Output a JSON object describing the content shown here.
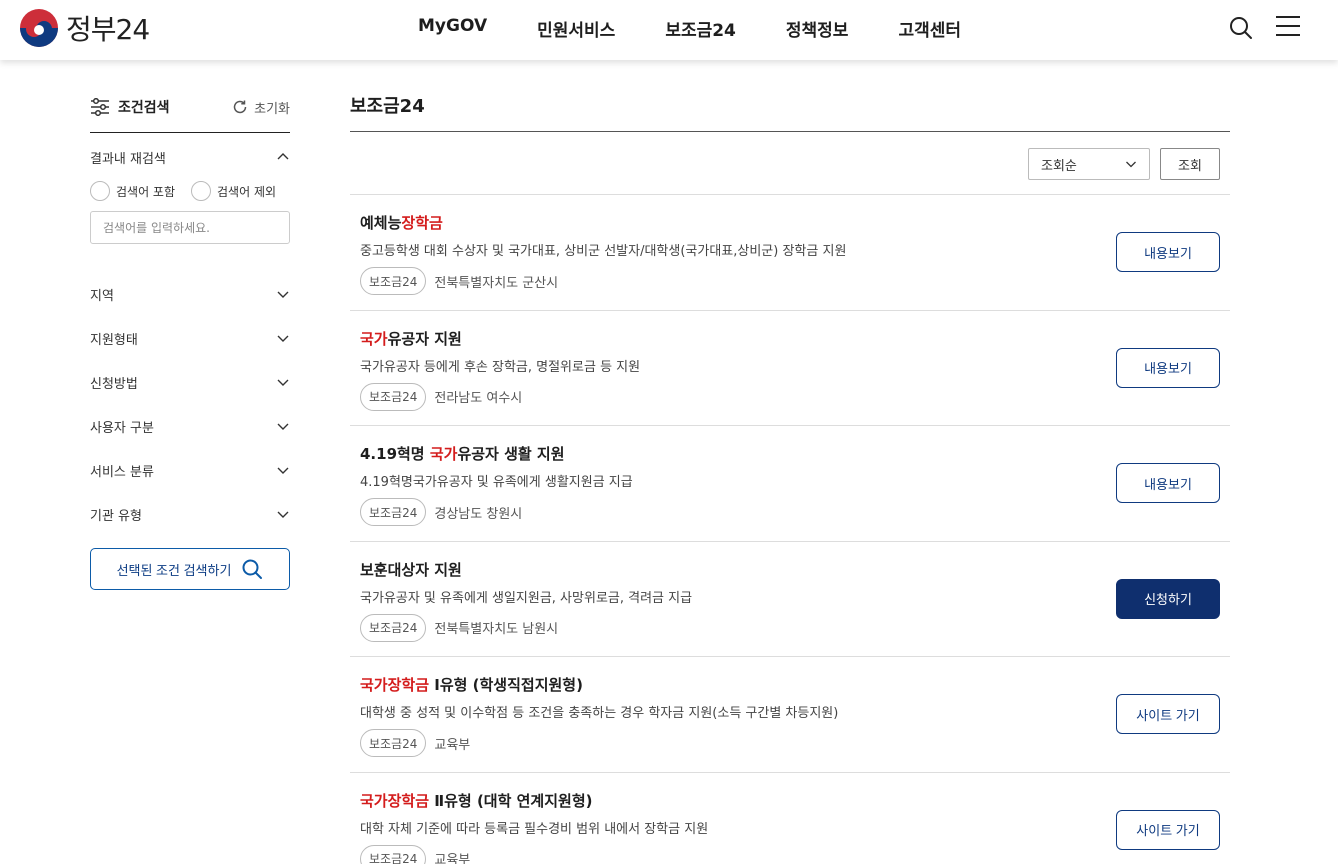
{
  "header": {
    "logo_text": "정부24",
    "nav": [
      "MyGOV",
      "민원서비스",
      "보조금24",
      "정책정보",
      "고객센터"
    ]
  },
  "sidebar": {
    "title": "조건검색",
    "reset": "초기화",
    "refine": {
      "label": "결과내 재검색",
      "include": "검색어 포함",
      "exclude": "검색어 제외",
      "placeholder": "검색어를 입력하세요."
    },
    "filters": [
      "지역",
      "지원형태",
      "신청방법",
      "사용자 구분",
      "서비스 분류",
      "기관 유형"
    ],
    "search_button": "선택된 조건 검색하기"
  },
  "main": {
    "title": "보조금24",
    "sort": {
      "selected": "조회순",
      "button": "조회"
    },
    "items": [
      {
        "title_parts": [
          {
            "text": "예체능",
            "hl": false
          },
          {
            "text": "장학금",
            "hl": true
          }
        ],
        "desc": "중고등학생 대회 수상자 및 국가대표, 상비군 선발자/대학생(국가대표,상비군) 장학금 지원",
        "tag": "보조금24",
        "region": "전북특별자치도 군산시",
        "button": "내용보기",
        "button_style": "outline"
      },
      {
        "title_parts": [
          {
            "text": "국가",
            "hl": true
          },
          {
            "text": "유공자 지원",
            "hl": false
          }
        ],
        "desc": "국가유공자 등에게 후손 장학금, 명절위로금 등 지원",
        "tag": "보조금24",
        "region": "전라남도 여수시",
        "button": "내용보기",
        "button_style": "outline"
      },
      {
        "title_parts": [
          {
            "text": "4.19혁명 ",
            "hl": false
          },
          {
            "text": "국가",
            "hl": true
          },
          {
            "text": "유공자 생활 지원",
            "hl": false
          }
        ],
        "desc": "4.19혁명국가유공자 및 유족에게 생활지원금 지급",
        "tag": "보조금24",
        "region": "경상남도 창원시",
        "button": "내용보기",
        "button_style": "outline"
      },
      {
        "title_parts": [
          {
            "text": "보훈대상자 지원",
            "hl": false
          }
        ],
        "desc": "국가유공자 및 유족에게 생일지원금, 사망위로금, 격려금 지급",
        "tag": "보조금24",
        "region": "전북특별자치도 남원시",
        "button": "신청하기",
        "button_style": "primary"
      },
      {
        "title_parts": [
          {
            "text": "국가장학금",
            "hl": true
          },
          {
            "text": " Ⅰ유형 (학생직접지원형)",
            "hl": false
          }
        ],
        "desc": "대학생 중 성적 및 이수학점 등 조건을 충족하는 경우 학자금 지원(소득 구간별 차등지원)",
        "tag": "보조금24",
        "region": "교육부",
        "button": "사이트 가기",
        "button_style": "outline"
      },
      {
        "title_parts": [
          {
            "text": "국가장학금",
            "hl": true
          },
          {
            "text": " Ⅱ유형 (대학 연계지원형)",
            "hl": false
          }
        ],
        "desc": "대학 자체 기준에 따라 등록금 필수경비 범위 내에서 장학금 지원",
        "tag": "보조금24",
        "region": "교육부",
        "button": "사이트 가기",
        "button_style": "outline"
      }
    ]
  }
}
